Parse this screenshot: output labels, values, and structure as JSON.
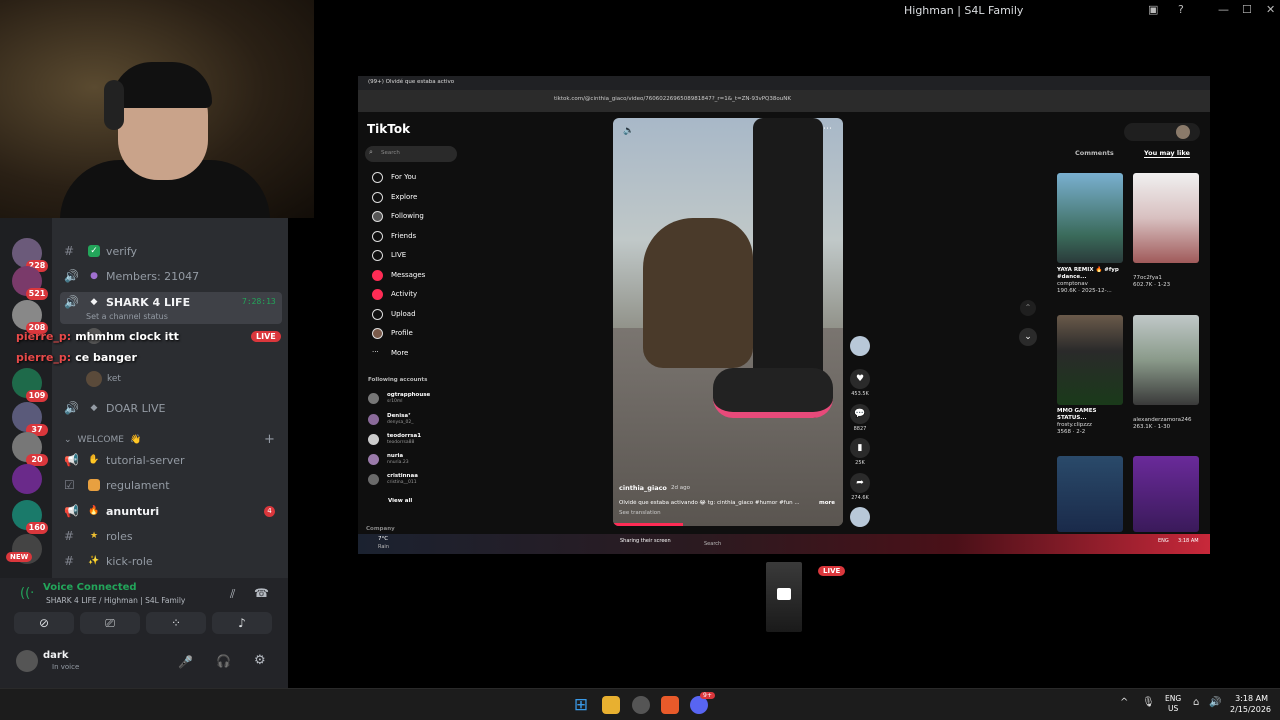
{
  "window": {
    "title": "Highman | S4L Family"
  },
  "servers": {
    "badges": [
      "208",
      "228",
      "521",
      "208",
      "109",
      "37",
      "20",
      "160",
      "208"
    ],
    "new_label": "NEW"
  },
  "channels": {
    "verify": "verify",
    "members": "Members: 21047",
    "shark": {
      "name": "SHARK 4 LIFE",
      "time": "7:28:13",
      "status": "Set a channel status"
    },
    "user_mhmm": "mhmhm clock itt",
    "user_banger": "ce banger",
    "live_badge": "LIVE",
    "user_ket": "ket",
    "doar": "DOAR LIVE",
    "category": "WELCOME",
    "tutorial": "tutorial-server",
    "regulament": "regulament",
    "anunturi": "anunturi",
    "anunturi_badge": "4",
    "roles": "roles",
    "kick": "kick-role"
  },
  "chat_overlay": {
    "user": "pierre_p:"
  },
  "voice": {
    "status": "Voice Connected",
    "channel": "SHARK 4 LIFE / Highman | S4L Family",
    "user": "dark",
    "user_status": "In voice"
  },
  "browser": {
    "tab": "(99+) Olvidé que estaba activo",
    "url": "tiktok.com/@cinthia_giaco/video/7606022696508981847?_r=1&_t=ZN-93vPQ38ouNK"
  },
  "tiktok": {
    "logo": "TikTok",
    "search_placeholder": "Search",
    "nav": [
      "For You",
      "Explore",
      "Following",
      "Friends",
      "LIVE",
      "Messages",
      "Activity",
      "Upload",
      "Profile",
      "More"
    ],
    "following_header": "Following accounts",
    "following": [
      {
        "name": "ogtrapphouse",
        "sub": "sr10ml"
      },
      {
        "name": "Denisa⁷",
        "sub": "denysa_02_"
      },
      {
        "name": "teodorrsa1",
        "sub": "teodorrsa88"
      },
      {
        "name": "nuria",
        "sub": "nnuria.23"
      },
      {
        "name": "cristinnaa",
        "sub": "cristina__011"
      }
    ],
    "view_all": "View all",
    "company": "Company",
    "video": {
      "author": "cinthia_giaco",
      "age": "2d ago",
      "caption": "Olvidé que estaba activando 😂 tg: cinthia_giaco #humor #fun ...",
      "more": "more",
      "translation": "See translation"
    },
    "actions": [
      "453.5K",
      "8827",
      "25K",
      "274.6K"
    ],
    "tabs": [
      "Comments",
      "You may like"
    ],
    "recommended": [
      {
        "title": "YAYA REMIX 🔥 #fyp #dance...",
        "author": "comptonav",
        "meta": "190.6K · 2025-12-..."
      },
      {
        "title": "",
        "author": "77oc2fya1",
        "meta": "602.7K · 1-23"
      },
      {
        "title": "MMO GAMES STATUS...",
        "author": "frosty.clipzzz",
        "meta": "3568 · 2-2"
      },
      {
        "title": "",
        "author": "alexanderzamora246",
        "meta": "263.1K · 1-30"
      }
    ]
  },
  "stream_taskbar": {
    "weather": "7°C",
    "weather_sub": "Rain",
    "sharing": "Sharing their screen",
    "search": "Search",
    "lang": "ENG",
    "clock": "3:18 AM"
  },
  "preview": {
    "live": "LIVE"
  },
  "taskbar": {
    "lang": "ENG",
    "region": "US",
    "time": "3:18 AM",
    "date": "2/15/2026",
    "discord_badge": "9+"
  },
  "colors": {
    "accent_red": "#da373c",
    "discord_bg": "#2b2d31",
    "voice_green": "#23a55a"
  }
}
